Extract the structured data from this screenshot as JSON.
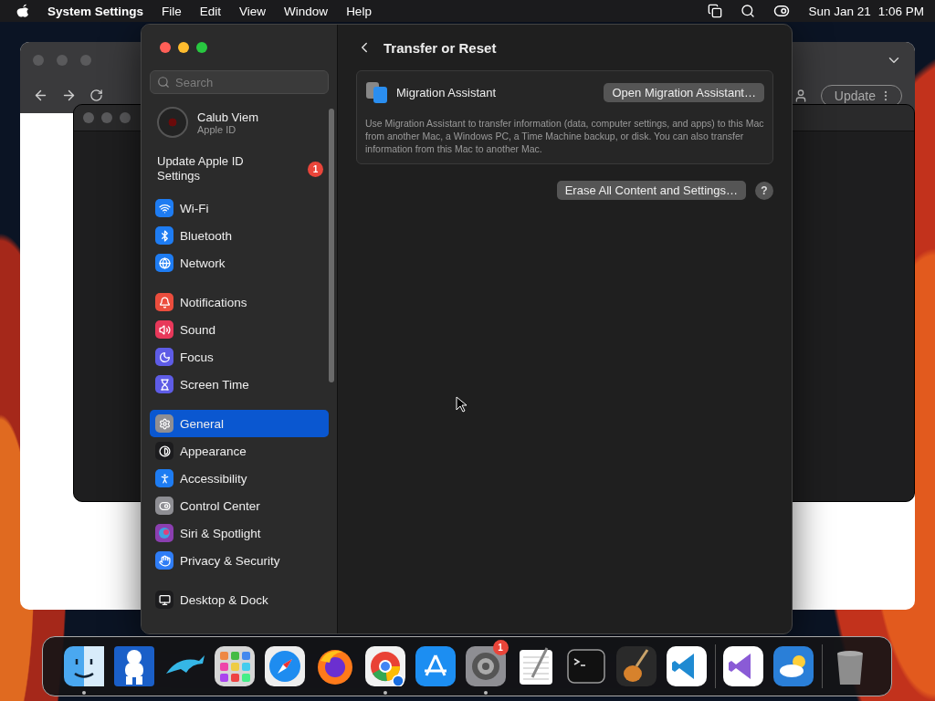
{
  "menu_bar": {
    "app_name": "System Settings",
    "menus": [
      "File",
      "Edit",
      "View",
      "Window",
      "Help"
    ],
    "date": "Sun Jan 21",
    "time": "1:06 PM"
  },
  "background_window": {
    "update_button": "Update"
  },
  "settings": {
    "search": {
      "placeholder": "Search"
    },
    "account": {
      "name": "Calub Viem",
      "subtitle": "Apple ID"
    },
    "account_alert": {
      "label": "Update Apple ID Settings",
      "badge": "1"
    },
    "sidebar_groups": [
      [
        {
          "label": "Wi-Fi",
          "color": "#1e7cf2",
          "selected": false
        },
        {
          "label": "Bluetooth",
          "color": "#1e7cf2",
          "selected": false
        },
        {
          "label": "Network",
          "color": "#1e7cf2",
          "selected": false
        }
      ],
      [
        {
          "label": "Notifications",
          "color": "#eb4d3d",
          "selected": false
        },
        {
          "label": "Sound",
          "color": "#e8385a",
          "selected": false
        },
        {
          "label": "Focus",
          "color": "#5e5ce6",
          "selected": false
        },
        {
          "label": "Screen Time",
          "color": "#5e5ce6",
          "selected": false
        }
      ],
      [
        {
          "label": "General",
          "color": "#8e8e93",
          "selected": true
        },
        {
          "label": "Appearance",
          "color": "#1c1c1e",
          "selected": false
        },
        {
          "label": "Accessibility",
          "color": "#1e7cf2",
          "selected": false
        },
        {
          "label": "Control Center",
          "color": "#8e8e93",
          "selected": false
        },
        {
          "label": "Siri & Spotlight",
          "color": "#8b3fb0",
          "selected": false
        },
        {
          "label": "Privacy & Security",
          "color": "#2f7df6",
          "selected": false
        }
      ],
      [
        {
          "label": "Desktop & Dock",
          "color": "#1c1c1e",
          "selected": false
        }
      ]
    ],
    "page": {
      "title": "Transfer or Reset",
      "migration": {
        "title": "Migration Assistant",
        "button": "Open Migration Assistant…",
        "description": "Use Migration Assistant to transfer information (data, computer settings, and apps) to this Mac from another Mac, a Windows PC, a Time Machine backup, or disk. You can also transfer information from this Mac to another Mac."
      },
      "erase_button": "Erase All Content and Settings…",
      "help_button": "?"
    }
  },
  "dock": {
    "apps": [
      {
        "kind": "finder",
        "running": true
      },
      {
        "kind": "mascot",
        "running": false
      },
      {
        "kind": "dolphin",
        "running": false
      },
      {
        "kind": "launchpad",
        "running": false
      },
      {
        "kind": "safari",
        "running": false
      },
      {
        "kind": "firefox",
        "running": false
      },
      {
        "kind": "chrome",
        "running": true
      },
      {
        "kind": "appstore",
        "running": false
      },
      {
        "kind": "settings",
        "running": true,
        "badge": "1"
      },
      {
        "kind": "textedit",
        "running": false
      },
      {
        "kind": "terminal",
        "running": false
      },
      {
        "kind": "guitar",
        "running": false
      },
      {
        "kind": "vscode",
        "running": false
      },
      {
        "kind": "divider"
      },
      {
        "kind": "visualstudio",
        "running": false
      },
      {
        "kind": "weather",
        "running": false
      },
      {
        "kind": "divider"
      },
      {
        "kind": "trash",
        "running": false
      }
    ]
  }
}
